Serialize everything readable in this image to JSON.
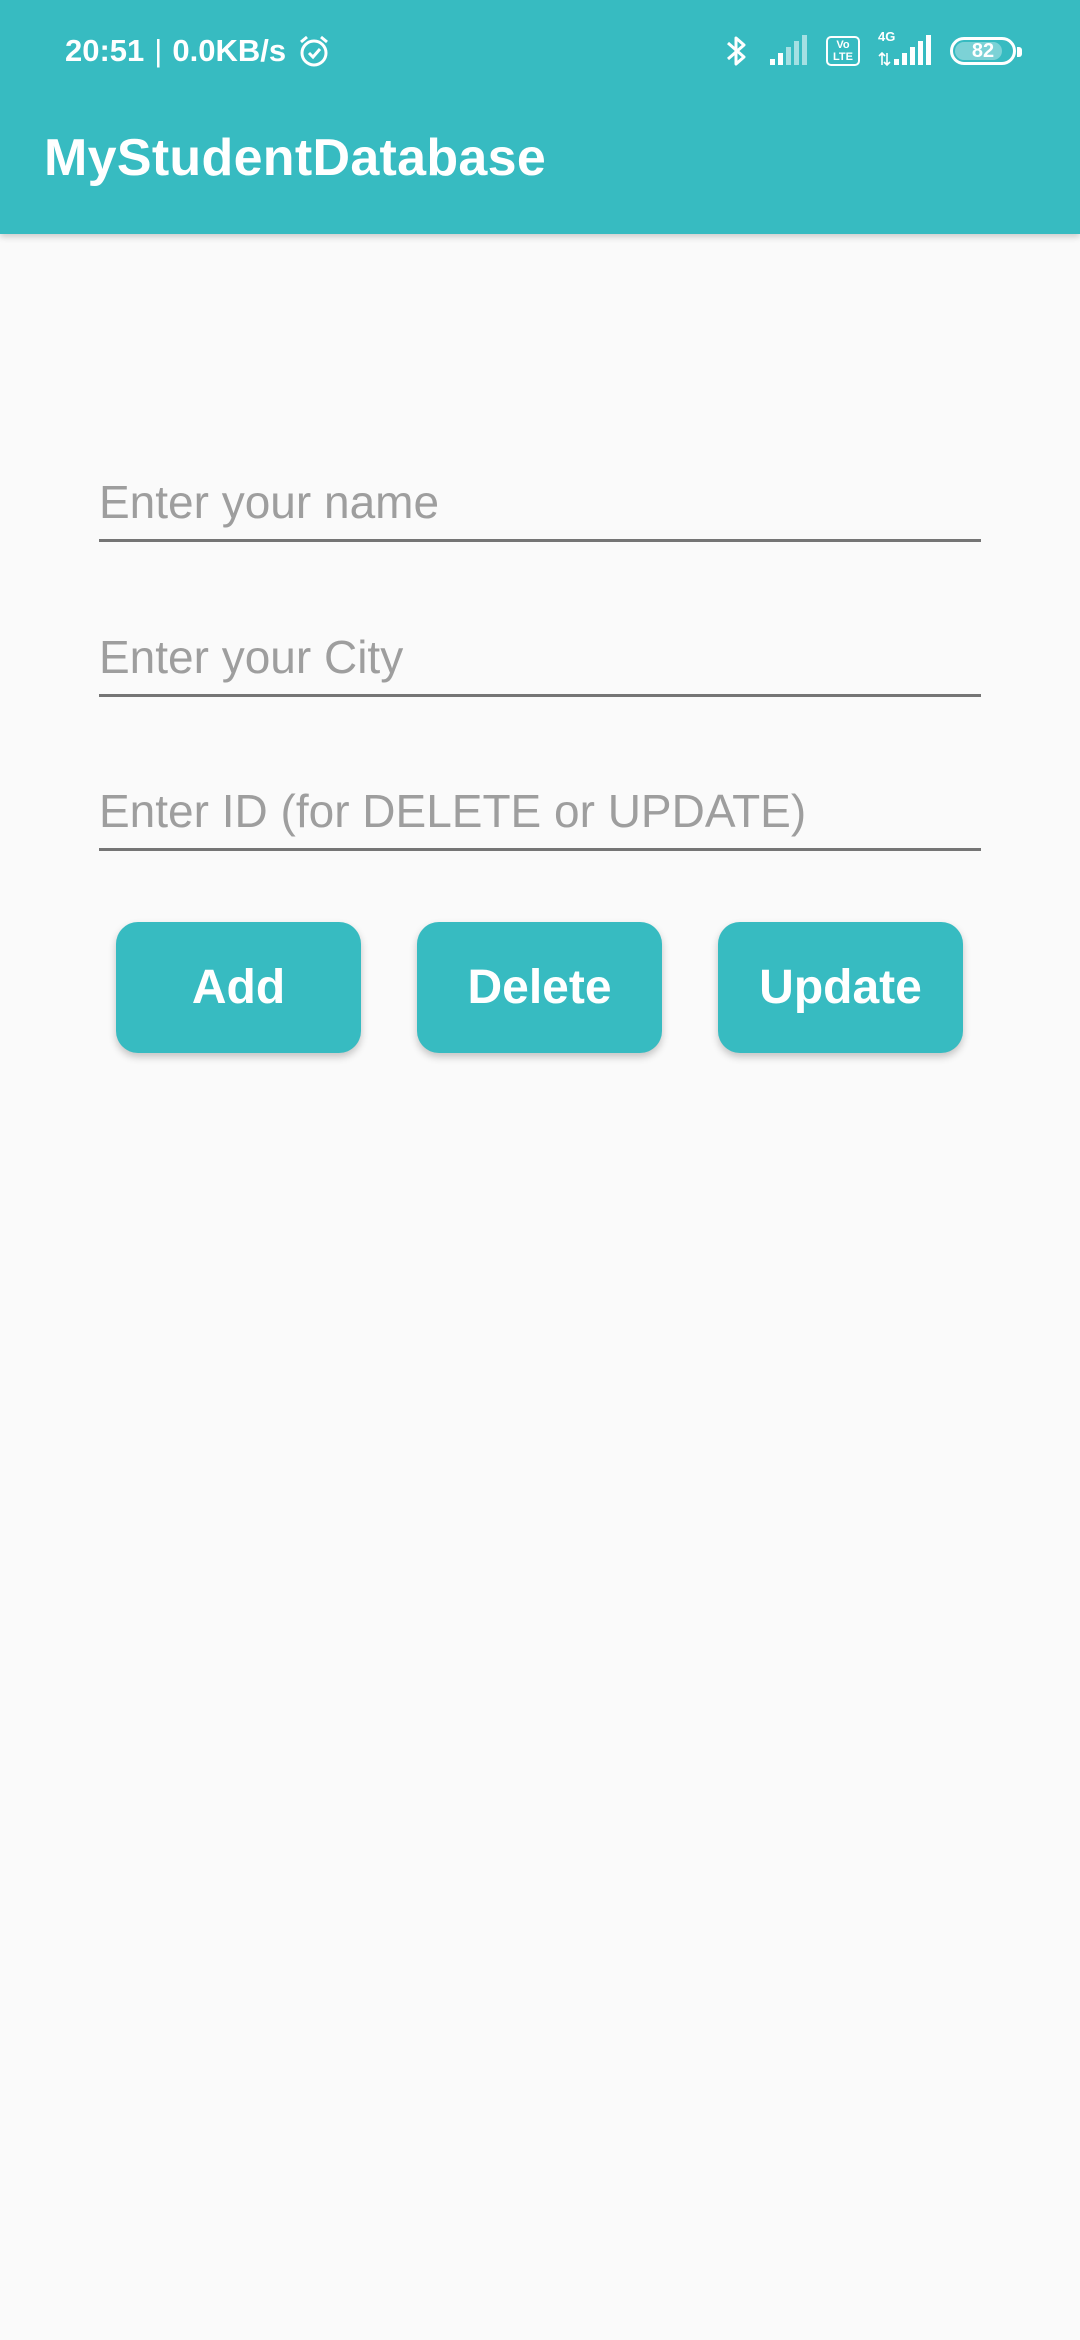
{
  "status_bar": {
    "time": "20:51",
    "separator": "|",
    "network_speed": "0.0KB/s",
    "alarm_icon": "alarm-icon",
    "bluetooth_icon": "bluetooth-icon",
    "signal_icon": "signal-icon",
    "volte_top": "Vo",
    "volte_bottom": "LTE",
    "network_type": "4G",
    "battery_level": "82"
  },
  "app_bar": {
    "title": "MyStudentDatabase",
    "color": "#37bbc1"
  },
  "form": {
    "name_field": {
      "value": "",
      "placeholder": "Enter your name"
    },
    "city_field": {
      "value": "",
      "placeholder": "Enter your City"
    },
    "id_field": {
      "value": "",
      "placeholder": "Enter ID (for DELETE or UPDATE)"
    }
  },
  "buttons": {
    "add": "Add",
    "delete": "Delete",
    "update": "Update"
  }
}
